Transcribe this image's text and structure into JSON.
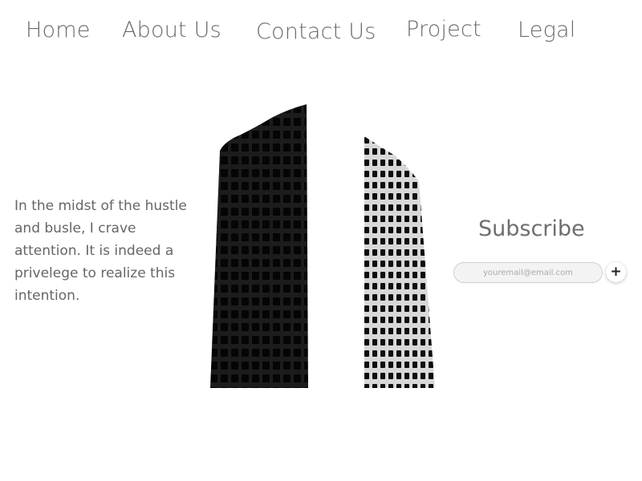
{
  "nav": {
    "items": [
      {
        "label": "Home"
      },
      {
        "label": "About Us"
      },
      {
        "label": "Contact Us"
      },
      {
        "label": "Project"
      },
      {
        "label": "Legal"
      }
    ]
  },
  "intro": {
    "text": "In the midst of the hustle and busle, I crave attention. It is indeed a privelege to realize this intention."
  },
  "images": {
    "left_building": "dark-tower-image",
    "right_building": "light-tower-image"
  },
  "subscribe": {
    "title": "Subscribe",
    "email_placeholder": "youremail@email.com",
    "email_value": "",
    "submit_icon": "+"
  }
}
